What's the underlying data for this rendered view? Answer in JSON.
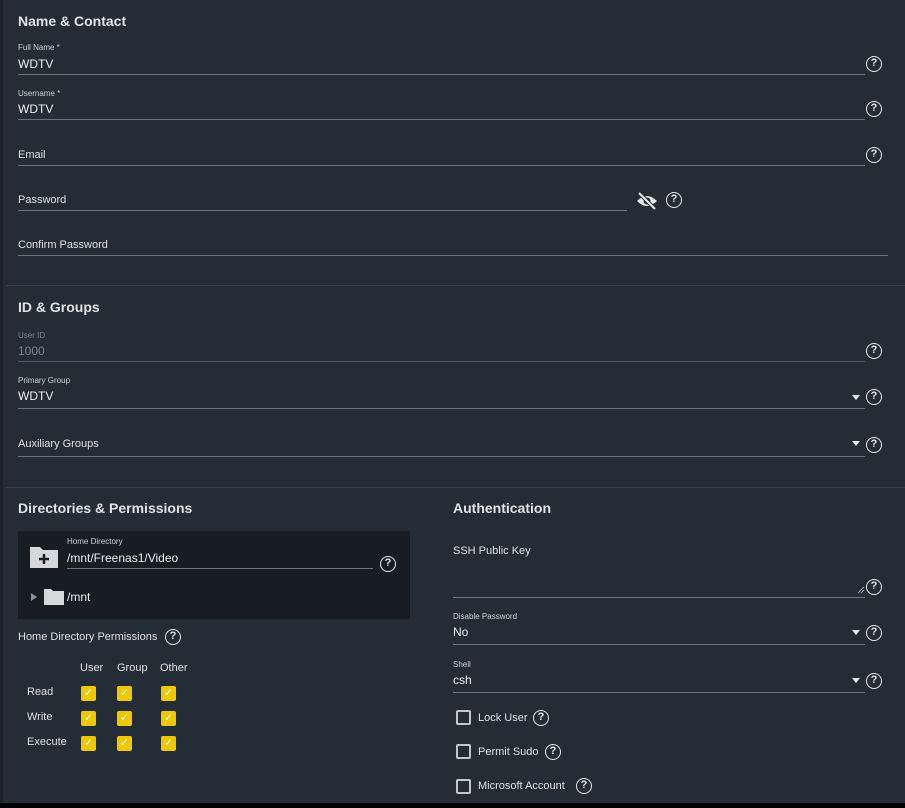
{
  "name_contact": {
    "title": "Name & Contact",
    "full_name_label": "Full Name *",
    "full_name": "WDTV",
    "username_label": "Username *",
    "username": "WDTV",
    "email_placeholder": "Email",
    "password_placeholder": "Password",
    "confirm_password_placeholder": "Confirm Password"
  },
  "id_groups": {
    "title": "ID & Groups",
    "user_id_label": "User ID",
    "user_id": "1000",
    "primary_group_label": "Primary Group",
    "primary_group": "WDTV",
    "auxiliary_groups_placeholder": "Auxiliary Groups"
  },
  "directories": {
    "title": "Directories & Permissions",
    "home_dir_label": "Home Directory",
    "home_dir": "/mnt/Freenas1/Video",
    "tree_root": "/mnt",
    "permissions_label": "Home Directory Permissions",
    "columns": [
      "User",
      "Group",
      "Other"
    ],
    "rows": [
      {
        "label": "Read",
        "checked": [
          true,
          true,
          true
        ]
      },
      {
        "label": "Write",
        "checked": [
          true,
          true,
          true
        ]
      },
      {
        "label": "Execute",
        "checked": [
          true,
          true,
          true
        ]
      }
    ]
  },
  "authentication": {
    "title": "Authentication",
    "ssh_key_placeholder": "SSH Public Key",
    "disable_password_label": "Disable Password",
    "disable_password": "No",
    "shell_label": "Shell",
    "shell": "csh",
    "lock_user": "Lock User",
    "permit_sudo": "Permit Sudo",
    "microsoft_account": "Microsoft Account"
  },
  "help_glyph": "?",
  "check_glyph": "✓"
}
